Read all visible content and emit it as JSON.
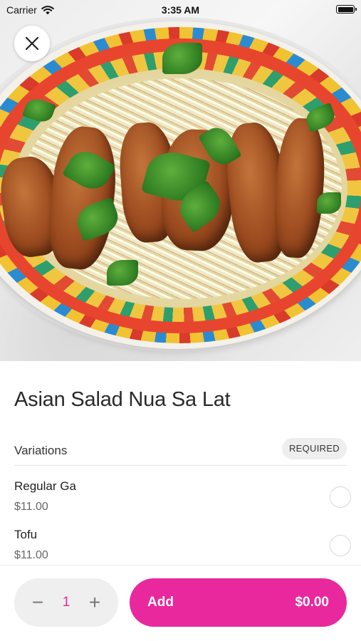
{
  "status_bar": {
    "carrier": "Carrier",
    "time": "3:35 AM"
  },
  "item": {
    "title": "Asian Salad Nua Sa Lat"
  },
  "variations": {
    "label": "Variations",
    "badge": "REQUIRED",
    "options": [
      {
        "name": "Regular Ga",
        "price": "$11.00"
      },
      {
        "name": "Tofu",
        "price": "$11.00"
      }
    ]
  },
  "footer": {
    "minus_symbol": "−",
    "quantity": "1",
    "plus_symbol": "+",
    "add_label": "Add",
    "add_price": "$0.00"
  },
  "colors": {
    "accent": "#e8289c",
    "quantity_pill_bg": "#efefef"
  },
  "icons": {
    "close": "close-icon",
    "wifi": "wifi-icon",
    "battery": "battery-icon"
  }
}
